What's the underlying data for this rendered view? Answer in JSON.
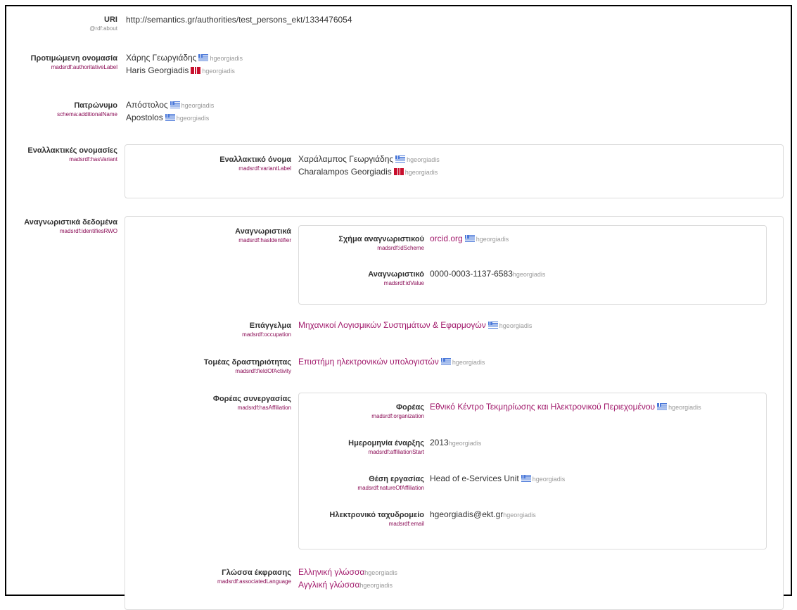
{
  "uri": {
    "label": "URI",
    "prop": "@rdf:about",
    "value": "http://semantics.gr/authorities/test_persons_ekt/1334476054"
  },
  "preferred_name": {
    "label": "Προτιμώμενη ονομασία",
    "prop": "madsrdf:authoritativeLabel",
    "values": [
      {
        "text": "Χάρης Γεωργιάδης",
        "flag": "gr",
        "user": "hgeorgiadis"
      },
      {
        "text": "Haris Georgiadis",
        "flag": "en",
        "user": "hgeorgiadis"
      }
    ]
  },
  "patronymic": {
    "label": "Πατρώνυμο",
    "prop": "schema:additionalName",
    "values": [
      {
        "text": "Απόστολος",
        "flag": "gr",
        "user": "hgeorgiadis"
      },
      {
        "text": "Apostolos",
        "flag": "gr",
        "user": "hgeorgiadis"
      }
    ]
  },
  "variants": {
    "label": "Εναλλακτικές ονομασίες",
    "prop": "madsrdf:hasVariant",
    "inner_label": "Εναλλακτικό όνομα",
    "inner_prop": "madsrdf:variantLabel",
    "values": [
      {
        "text": "Χαράλαμπος Γεωργιάδης",
        "flag": "gr",
        "user": "hgeorgiadis"
      },
      {
        "text": "Charalampos Georgiadis",
        "flag": "en",
        "user": "hgeorgiadis"
      }
    ]
  },
  "identifying": {
    "label": "Αναγνωριστικά δεδομένα",
    "prop": "madsrdf:identifiesRWO",
    "identifiers": {
      "label": "Αναγνωριστικά",
      "prop": "madsrdf:hasIdentifier",
      "scheme": {
        "label": "Σχήμα αναγνωριστικού",
        "prop": "madsrdf:idScheme",
        "value": "orcid.org",
        "user": "hgeorgiadis"
      },
      "value": {
        "label": "Αναγνωριστικό",
        "prop": "madsrdf:idValue",
        "value": "0000-0003-1137-6583",
        "user": "hgeorgiadis"
      }
    },
    "occupation": {
      "label": "Επάγγελμα",
      "prop": "madsrdf:occupation",
      "value": "Μηχανικοί Λογισμικών Συστημάτων & Εφαρμογών",
      "user": "hgeorgiadis"
    },
    "field": {
      "label": "Τομέας δραστηριότητας",
      "prop": "madsrdf:fieldOfActivity",
      "value": "Επιστήμη ηλεκτρονικών υπολογιστών",
      "user": "hgeorgiadis"
    },
    "affiliation": {
      "label": "Φορέας συνεργασίας",
      "prop": "madsrdf:hasAffiliation",
      "organization": {
        "label": "Φορέας",
        "prop": "madsrdf:organization",
        "value": "Εθνικό Κέντρο Τεκμηρίωσης και Ηλεκτρονικού Περιεχομένου",
        "user": "hgeorgiadis"
      },
      "start": {
        "label": "Ημερομηνία έναρξης",
        "prop": "madsrdf:affiliationStart",
        "value": "2013",
        "user": "hgeorgiadis"
      },
      "position": {
        "label": "Θέση εργασίας",
        "prop": "madsrdf:natureOfAffiliation",
        "value": "Head of e-Services Unit",
        "user": "hgeorgiadis"
      },
      "email": {
        "label": "Ηλεκτρονικό ταχυδρομείο",
        "prop": "madsrdf:email",
        "value": "hgeorgiadis@ekt.gr",
        "user": "hgeorgiadis"
      }
    },
    "language": {
      "label": "Γλώσσα έκφρασης",
      "prop": "madsrdf:associatedLanguage",
      "values": [
        {
          "text": "Ελληνική γλώσσα",
          "user": "hgeorgiadis"
        },
        {
          "text": "Αγγλική γλώσσα",
          "user": "hgeorgiadis"
        }
      ]
    }
  },
  "colors": {
    "link": "#a1196b",
    "prop": "#8a0b55",
    "user": "#999999",
    "border": "#dcdcdc"
  }
}
